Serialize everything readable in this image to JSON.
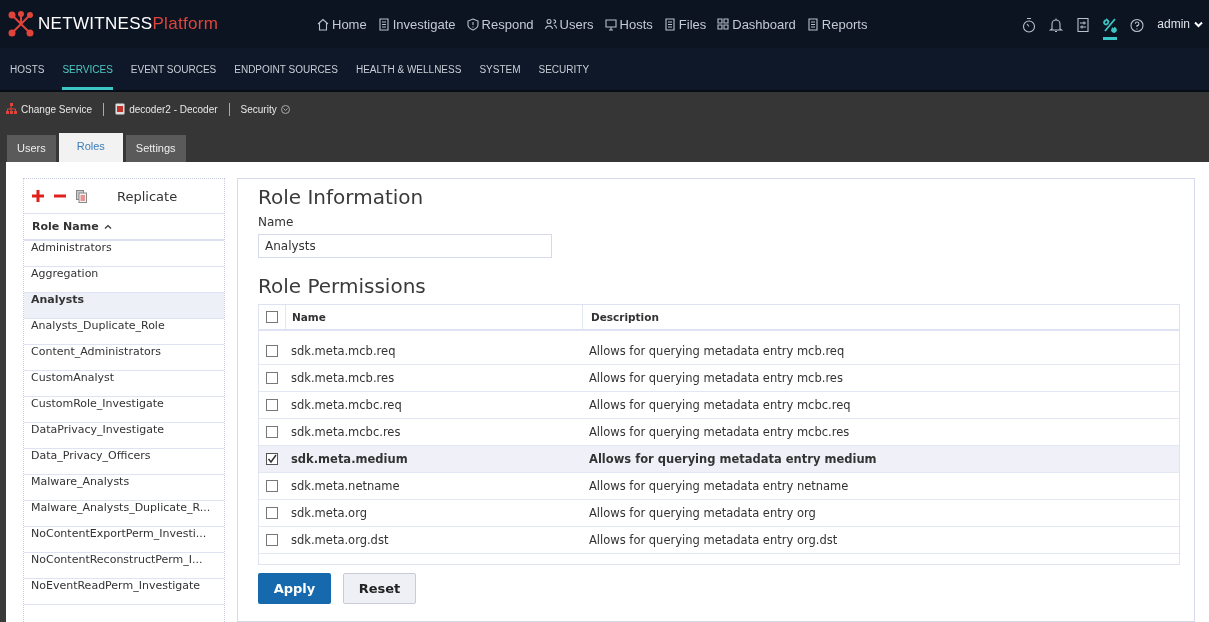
{
  "brand": {
    "name": "NETWITNESS",
    "suffix": "Platform"
  },
  "top_nav": [
    {
      "label": "Home",
      "kind": "home"
    },
    {
      "label": "Investigate",
      "kind": "doc"
    },
    {
      "label": "Respond",
      "kind": "shield"
    },
    {
      "label": "Users",
      "kind": "users"
    },
    {
      "label": "Hosts",
      "kind": "host"
    },
    {
      "label": "Files",
      "kind": "doc"
    },
    {
      "label": "Dashboard",
      "kind": "grid"
    },
    {
      "label": "Reports",
      "kind": "doc"
    }
  ],
  "tools": [
    {
      "kind": "timer",
      "selected": false
    },
    {
      "kind": "bell",
      "selected": false
    },
    {
      "kind": "panel",
      "selected": false
    },
    {
      "kind": "tools",
      "selected": true
    },
    {
      "kind": "help",
      "selected": false
    }
  ],
  "user": "admin",
  "admin_nav": [
    {
      "label": "HOSTS",
      "selected": false
    },
    {
      "label": "SERVICES",
      "selected": true
    },
    {
      "label": "EVENT SOURCES",
      "selected": false
    },
    {
      "label": "ENDPOINT SOURCES",
      "selected": false
    },
    {
      "label": "HEALTH & WELLNESS",
      "selected": false
    },
    {
      "label": "SYSTEM",
      "selected": false
    },
    {
      "label": "SECURITY",
      "selected": false
    }
  ],
  "service_bar": {
    "change": "Change Service",
    "service": "decoder2 - Decoder",
    "view": "Security"
  },
  "tabs": [
    {
      "label": "Users",
      "selected": false
    },
    {
      "label": "Roles",
      "selected": true
    },
    {
      "label": "Settings",
      "selected": false
    }
  ],
  "roles": {
    "replicate": "Replicate",
    "column": "Role Name",
    "items": [
      {
        "name": "Administrators",
        "selected": false
      },
      {
        "name": "Aggregation",
        "selected": false
      },
      {
        "name": "Analysts",
        "selected": true
      },
      {
        "name": "Analysts_Duplicate_Role",
        "selected": false
      },
      {
        "name": "Content_Administrators",
        "selected": false
      },
      {
        "name": "CustomAnalyst",
        "selected": false
      },
      {
        "name": "CustomRole_Investigate",
        "selected": false
      },
      {
        "name": "DataPrivacy_Investigate",
        "selected": false
      },
      {
        "name": "Data_Privacy_Officers",
        "selected": false
      },
      {
        "name": "Malware_Analysts",
        "selected": false
      },
      {
        "name": "Malware_Analysts_Duplicate_R...",
        "selected": false
      },
      {
        "name": "NoContentExportPerm_Investi...",
        "selected": false
      },
      {
        "name": "NoContentReconstructPerm_I...",
        "selected": false
      },
      {
        "name": "NoEventReadPerm_Investigate",
        "selected": false
      }
    ]
  },
  "role_info": {
    "title": "Role Information",
    "name_label": "Name",
    "name_value": "Analysts"
  },
  "permissions": {
    "title": "Role Permissions",
    "all_checked": false,
    "columns": [
      "Name",
      "Description"
    ],
    "rows": [
      {
        "name": "sdk.meta.mcb.req",
        "description": "Allows for querying metadata entry mcb.req",
        "checked": false,
        "selected": false
      },
      {
        "name": "sdk.meta.mcb.res",
        "description": "Allows for querying metadata entry mcb.res",
        "checked": false,
        "selected": false
      },
      {
        "name": "sdk.meta.mcbc.req",
        "description": "Allows for querying metadata entry mcbc.req",
        "checked": false,
        "selected": false
      },
      {
        "name": "sdk.meta.mcbc.res",
        "description": "Allows for querying metadata entry mcbc.res",
        "checked": false,
        "selected": false
      },
      {
        "name": "sdk.meta.medium",
        "description": "Allows for querying metadata entry medium",
        "checked": true,
        "selected": true
      },
      {
        "name": "sdk.meta.netname",
        "description": "Allows for querying metadata entry netname",
        "checked": false,
        "selected": false
      },
      {
        "name": "sdk.meta.org",
        "description": "Allows for querying metadata entry org",
        "checked": false,
        "selected": false
      },
      {
        "name": "sdk.meta.org.dst",
        "description": "Allows for querying metadata entry org.dst",
        "checked": false,
        "selected": false
      }
    ]
  },
  "buttons": {
    "apply": "Apply",
    "reset": "Reset"
  }
}
